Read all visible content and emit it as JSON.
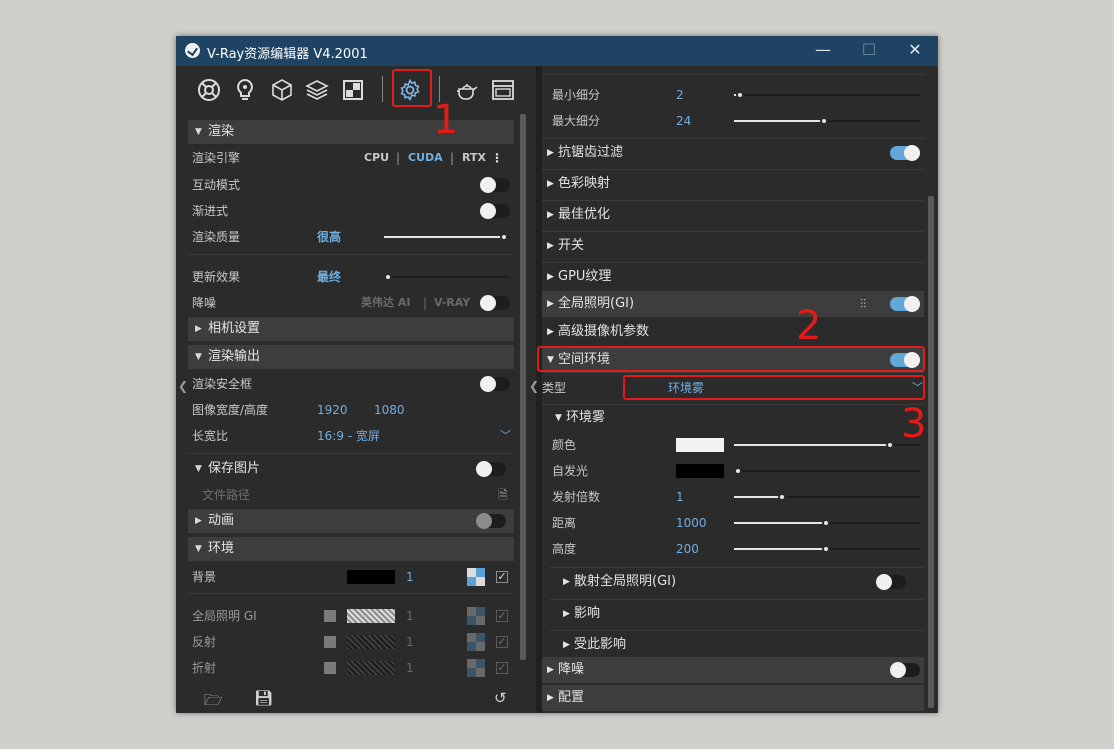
{
  "window": {
    "title": "V-Ray资源编辑器 V4.2001",
    "min_glyph": "—",
    "max_glyph": "☐",
    "close_glyph": "✕"
  },
  "toolbar": {
    "icons": [
      "lights-icon",
      "bulb-icon",
      "cube-icon",
      "layers-icon",
      "render-elements-icon",
      "settings-icon",
      "teapot-icon",
      "frame-buffer-icon"
    ]
  },
  "left": {
    "render": {
      "header": "渲染",
      "engine_label": "渲染引擎",
      "engine_cpu": "CPU",
      "engine_cuda": "CUDA",
      "engine_rtx": "RTX",
      "interactive_label": "互动模式",
      "progressive_label": "渐进式",
      "quality_label": "渲染质量",
      "quality_value": "很高",
      "update_label": "更新效果",
      "update_value": "最终",
      "denoise_label": "降噪",
      "denoise_ai": "英伟达 AI",
      "denoise_vray": "V-RAY"
    },
    "camera": {
      "header": "相机设置"
    },
    "output": {
      "header": "渲染输出",
      "safe_frame_label": "渲染安全框",
      "size_label": "图像宽度/高度",
      "width": "1920",
      "height": "1080",
      "aspect_label": "长宽比",
      "aspect_value": "16:9 - 宽屏"
    },
    "save": {
      "header": "保存图片",
      "path_label": "文件路径"
    },
    "animation": {
      "header": "动画"
    },
    "environment": {
      "header": "环境",
      "bg_label": "背景",
      "bg_value": "1",
      "gi_label": "全局照明 GI",
      "gi_value": "1",
      "refl_label": "反射",
      "refl_value": "1",
      "refr_label": "折射",
      "refr_value": "1"
    }
  },
  "right": {
    "min_sub_label": "最小细分",
    "min_sub_value": "2",
    "max_sub_label": "最大细分",
    "max_sub_value": "24",
    "antialias": "抗锯齿过滤",
    "color_mapping": "色彩映射",
    "optimization": "最佳优化",
    "switches": "开关",
    "gpu_textures": "GPU纹理",
    "gi": "全局照明(GI)",
    "adv_camera": "高级摄像机参数",
    "volume_env": "空间环境",
    "type_label": "类型",
    "type_value": "环境雾",
    "fog": {
      "header": "环境雾",
      "color_label": "颜色",
      "emission_label": "自发光",
      "emission_mult_label": "发射倍数",
      "emission_mult_value": "1",
      "distance_label": "距离",
      "distance_value": "1000",
      "height_label": "高度",
      "height_value": "200",
      "scatter_gi": "散射全局照明(GI)",
      "affect": "影响",
      "affected_by": "受此影响"
    },
    "denoiser": "降噪",
    "configuration": "配置"
  },
  "annotations": {
    "n1": "1",
    "n2": "2",
    "n3": "3",
    "color": "#e01b1b"
  }
}
